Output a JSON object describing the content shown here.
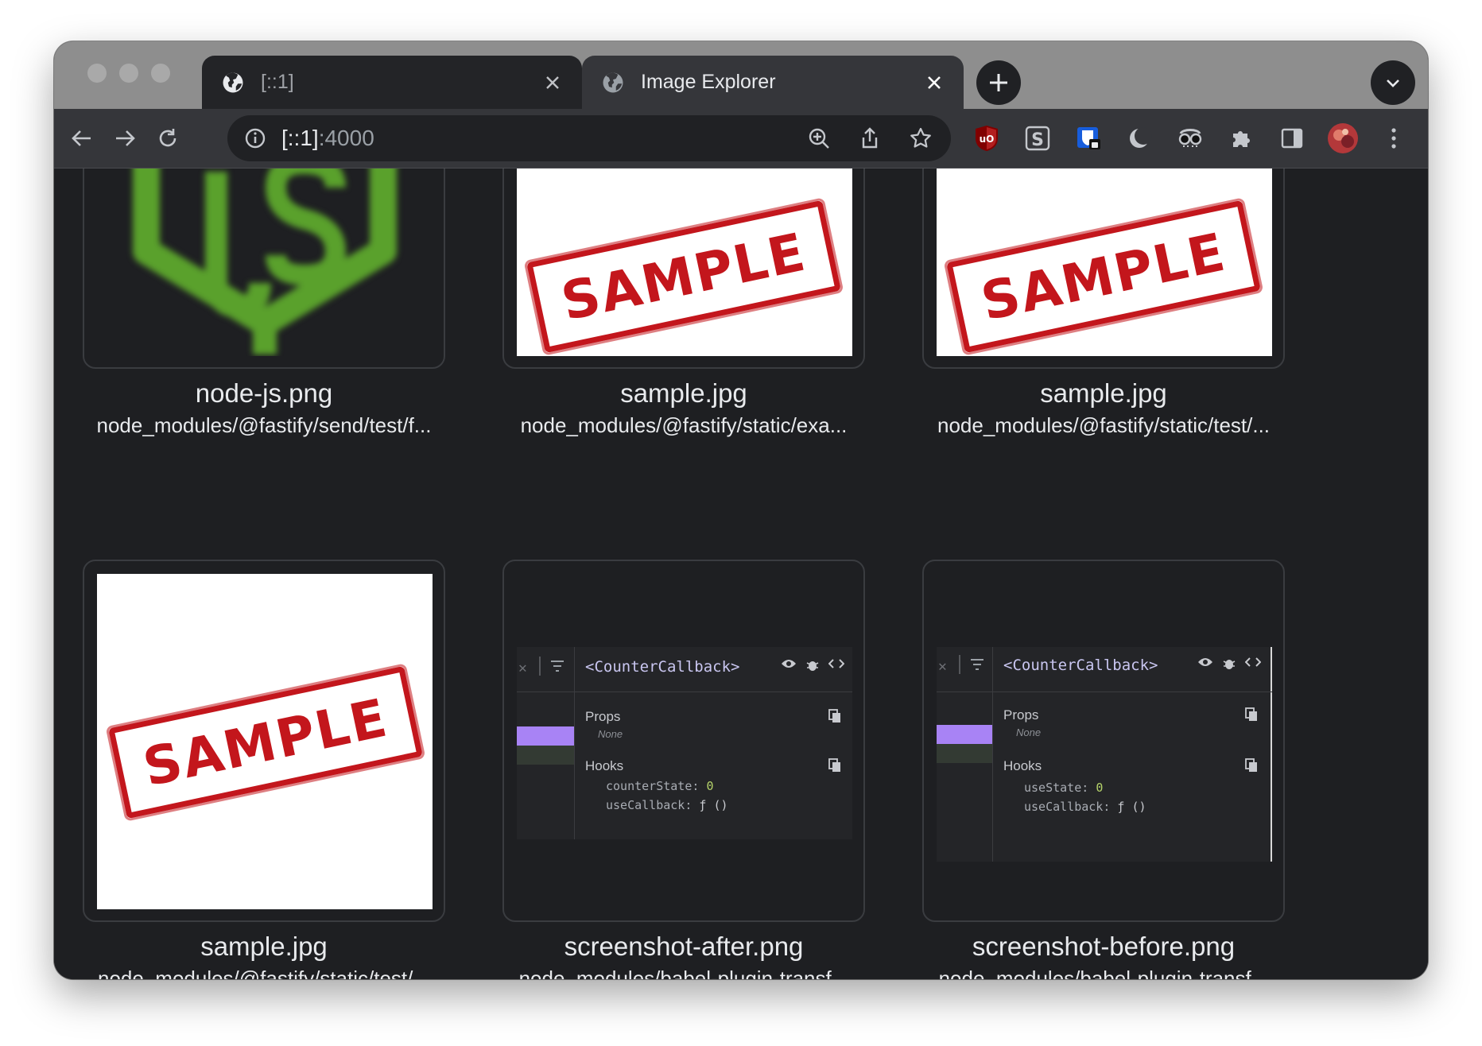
{
  "tabs": [
    {
      "title": "[::1]",
      "active": false
    },
    {
      "title": "Image Explorer",
      "active": true
    }
  ],
  "address": {
    "host": "[::1]",
    "port": ":4000"
  },
  "images": [
    {
      "name": "node-js.png",
      "path": "node_modules/@fastify/send/test/f..."
    },
    {
      "name": "sample.jpg",
      "path": "node_modules/@fastify/static/exa..."
    },
    {
      "name": "sample.jpg",
      "path": "node_modules/@fastify/static/test/..."
    },
    {
      "name": "sample.jpg",
      "path": "node_modules/@fastify/static/test/..."
    },
    {
      "name": "screenshot-after.png",
      "path": "node_modules/babel-plugin-transf..."
    },
    {
      "name": "screenshot-before.png",
      "path": "node_modules/babel-plugin-transf..."
    }
  ],
  "thumbnails": {
    "stamp_text": "SAMPLE",
    "devtools": {
      "component": "<CounterCallback>",
      "props_label": "Props",
      "props_value": "None",
      "hooks_label": "Hooks",
      "hook1_name": "counterState:",
      "hook1_value": "0",
      "hook2_name": "useCallback:",
      "hook2_value": "ƒ ()"
    }
  },
  "colors": {
    "page_bg": "#1e1f22",
    "stamp_red": "#c3161c",
    "node_green": "#5aa12c",
    "devtools_purple": "#a883f5"
  }
}
